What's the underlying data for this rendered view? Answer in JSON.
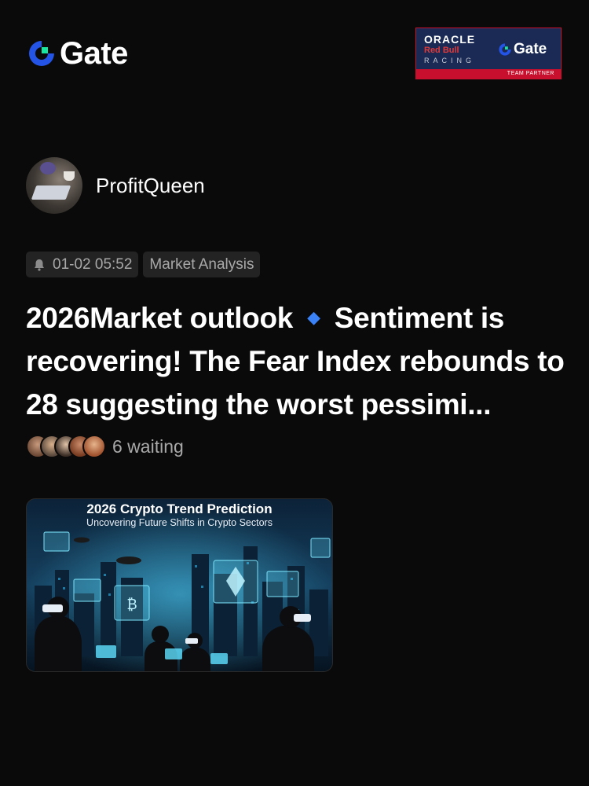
{
  "header": {
    "brand_name": "Gate",
    "partner": {
      "oracle": "ORACLE",
      "redbull": "Red Bull",
      "racing": "RACING",
      "gate": "Gate",
      "team": "TEAM PARTNER"
    }
  },
  "author": {
    "name": "ProfitQueen"
  },
  "meta": {
    "time": "01-02 05:52",
    "category": "Market Analysis"
  },
  "post": {
    "title_part1": "2026Market outlook",
    "diamond": "🔹",
    "title_part2": "Sentiment is recovering! The Fear Index rebounds to 28 suggesting the worst pessimi..."
  },
  "waiting": {
    "text": "6 waiting"
  },
  "image_card": {
    "title": "2026 Crypto Trend Prediction",
    "subtitle": "Uncovering Future Shifts in Crypto Sectors"
  },
  "colors": {
    "background": "#0a0a0a",
    "brand_blue": "#2354e6",
    "brand_green": "#17e6a1",
    "accent_diamond": "#3b82f6",
    "chip_bg": "#232323",
    "muted_text": "#a8a8a8"
  }
}
